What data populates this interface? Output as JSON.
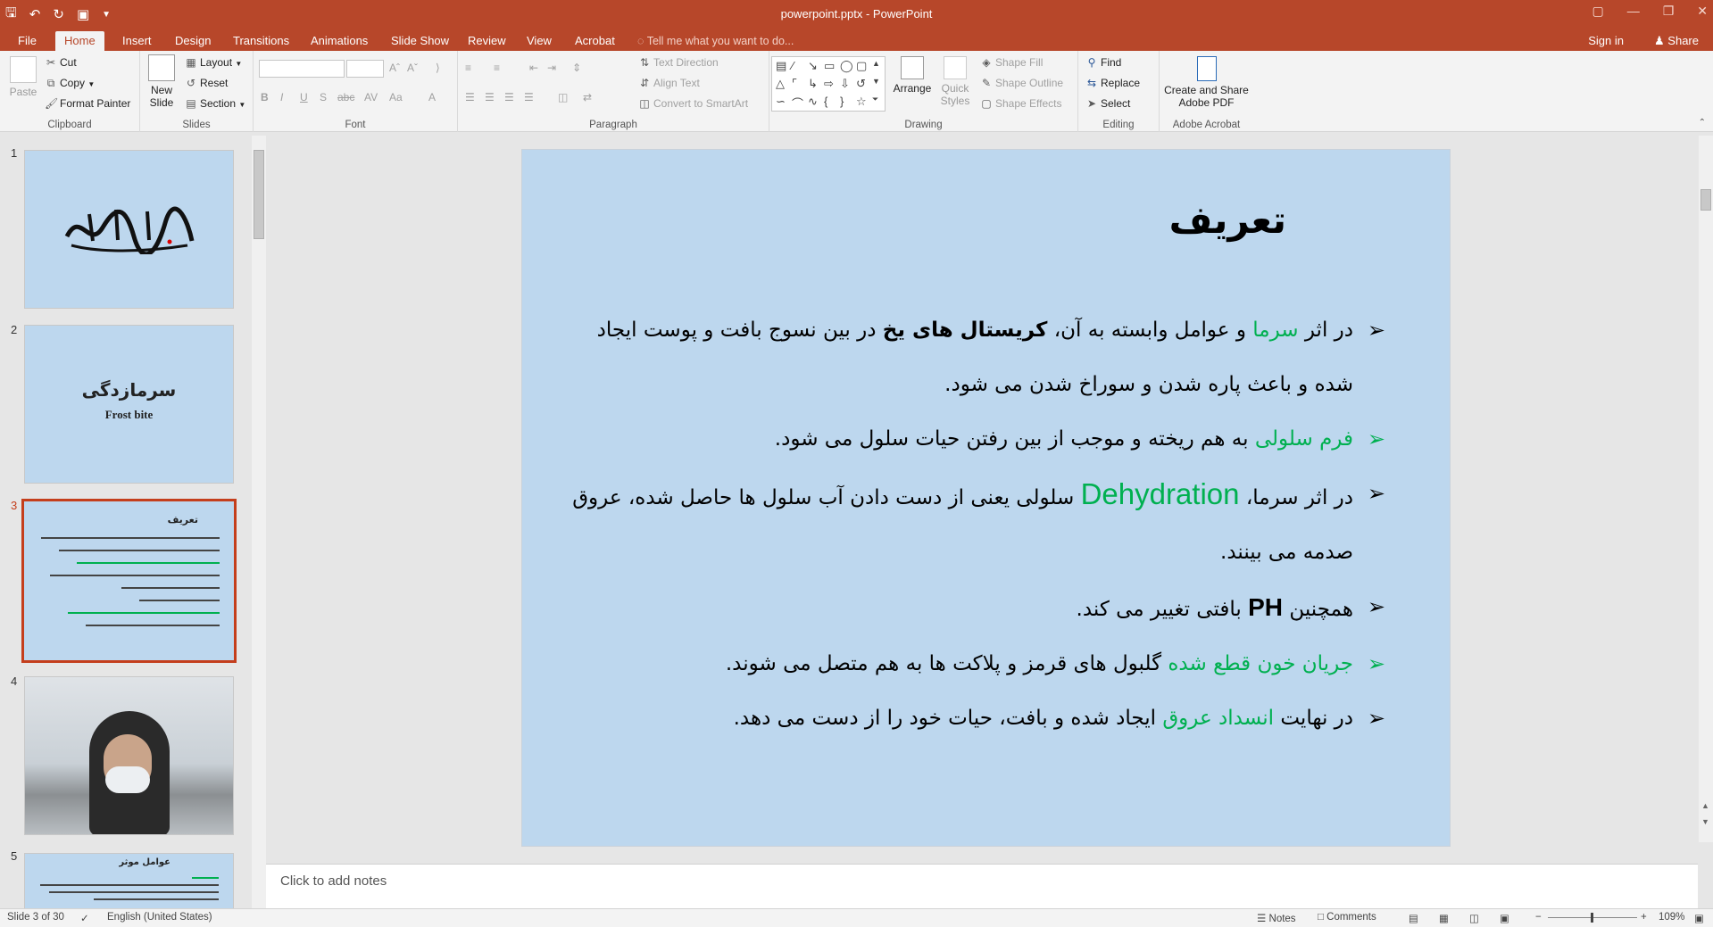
{
  "titlebar": {
    "title": "powerpoint.pptx - PowerPoint",
    "qat_icons": [
      "save-icon",
      "undo-icon",
      "redo-icon",
      "present-icon",
      "customize-icon"
    ]
  },
  "tabs": [
    "File",
    "Home",
    "Insert",
    "Design",
    "Transitions",
    "Animations",
    "Slide Show",
    "Review",
    "View",
    "Acrobat"
  ],
  "active_tab": "Home",
  "tell_me": "Tell me what you want to do...",
  "account": {
    "signin": "Sign in",
    "share": "Share"
  },
  "ribbon": {
    "clipboard": {
      "label": "Clipboard",
      "paste": "Paste",
      "cut": "Cut",
      "copy": "Copy",
      "format_painter": "Format Painter"
    },
    "slides": {
      "label": "Slides",
      "new_slide_line1": "New",
      "new_slide_line2": "Slide",
      "layout": "Layout",
      "reset": "Reset",
      "section": "Section"
    },
    "font": {
      "label": "Font"
    },
    "paragraph": {
      "label": "Paragraph",
      "text_direction": "Text Direction",
      "align_text": "Align Text",
      "convert_smartart": "Convert to SmartArt"
    },
    "drawing": {
      "label": "Drawing",
      "arrange": "Arrange",
      "quick_line1": "Quick",
      "quick_line2": "Styles",
      "shape_fill": "Shape Fill",
      "shape_outline": "Shape Outline",
      "shape_effects": "Shape Effects"
    },
    "editing": {
      "label": "Editing",
      "find": "Find",
      "replace": "Replace",
      "select": "Select"
    },
    "acrobat": {
      "label": "Adobe Acrobat",
      "line1": "Create and Share",
      "line2": "Adobe PDF"
    }
  },
  "thumbnails": [
    {
      "num": "1",
      "caption": ""
    },
    {
      "num": "2",
      "title": "سرمازدگی",
      "subtitle": "Frost bite"
    },
    {
      "num": "3",
      "title": "تعریف"
    },
    {
      "num": "4"
    },
    {
      "num": "5",
      "title": "عوامل موثر"
    }
  ],
  "slide": {
    "title": "تعریف",
    "b1_p1": "در اثر ",
    "b1_g1": "سرما",
    "b1_p2": " و عوامل وابسته به آن، ",
    "b1_bold": "کریستال های یخ",
    "b1_p3": " در بین نسوج بافت و پوست ایجاد شده و باعث پاره شدن و سوراخ شدن می شود.",
    "b2_g1": "فرم سلولی",
    "b2_p1": " به هم ریخته و موجب از بین رفتن حیات سلول می شود.",
    "b3_p1": "در اثر سرما،  ",
    "b3_g1": "Dehydration",
    "b3_p2": "  سلولی یعنی از دست دادن آب سلول ها حاصل شده، عروق صدمه می بینند.",
    "b4_p1": "همچنین ",
    "b4_bold": "PH",
    "b4_p2": " بافتی تغییر می کند.",
    "b5_g1": "جریان خون قطع شده",
    "b5_p1": " گلبول های قرمز و پلاکت ها به هم متصل می شوند.",
    "b6_p1": "در نهایت ",
    "b6_g1": "انسداد عروق",
    "b6_p2": " ایجاد شده و بافت، حیات خود را از دست می دهد."
  },
  "notes_placeholder": "Click to add notes",
  "status": {
    "slide": "Slide 3 of 30",
    "language": "English (United States)",
    "notes": "Notes",
    "comments": "Comments",
    "zoom": "109%"
  },
  "colors": {
    "accent": "#b7472a",
    "slide_bg": "#bdd7ee",
    "green": "#00b050"
  }
}
